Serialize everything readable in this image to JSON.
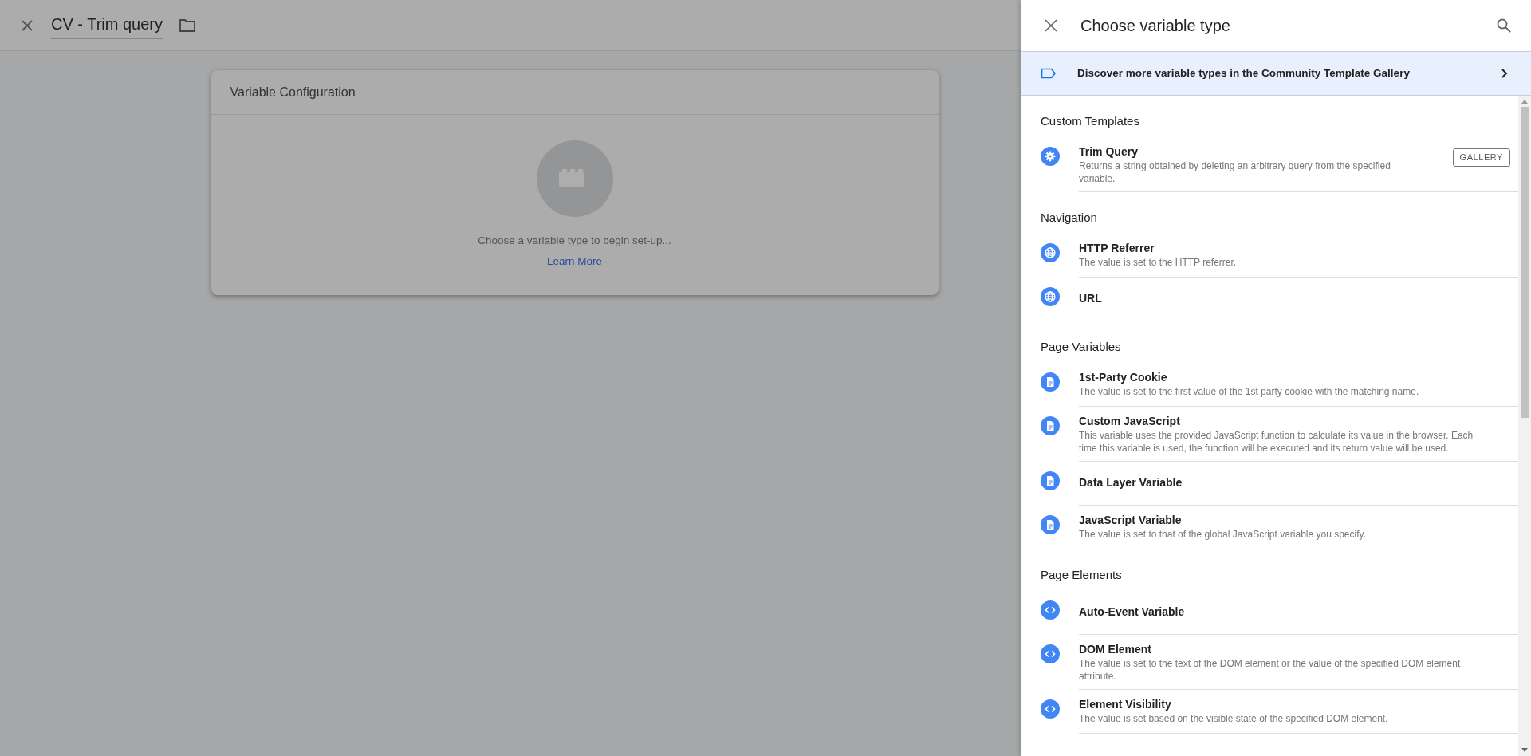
{
  "editor": {
    "title": "CV - Trim query",
    "card": {
      "title": "Variable Configuration",
      "hint": "Choose a variable type to begin set-up...",
      "link": "Learn More"
    }
  },
  "panel": {
    "title": "Choose variable type",
    "banner": "Discover more variable types in the Community Template Gallery",
    "sections": [
      {
        "title": "Custom Templates",
        "items": [
          {
            "kind": "gear",
            "name": "Trim Query",
            "description": "Returns a string obtained by deleting an arbitrary query from the specified variable.",
            "badge": "GALLERY"
          }
        ]
      },
      {
        "title": "Navigation",
        "items": [
          {
            "kind": "globe",
            "name": "HTTP Referrer",
            "description": "The value is set to the HTTP referrer."
          },
          {
            "kind": "globe",
            "name": "URL"
          }
        ]
      },
      {
        "title": "Page Variables",
        "items": [
          {
            "kind": "doc",
            "name": "1st-Party Cookie",
            "description": "The value is set to the first value of the 1st party cookie with the matching name."
          },
          {
            "kind": "doc",
            "name": "Custom JavaScript",
            "description": "This variable uses the provided JavaScript function to calculate its value in the browser. Each time this variable is used, the function will be executed and its return value will be used."
          },
          {
            "kind": "doc",
            "name": "Data Layer Variable"
          },
          {
            "kind": "doc",
            "name": "JavaScript Variable",
            "description": "The value is set to that of the global JavaScript variable you specify."
          }
        ]
      },
      {
        "title": "Page Elements",
        "items": [
          {
            "kind": "code",
            "name": "Auto-Event Variable"
          },
          {
            "kind": "code",
            "name": "DOM Element",
            "description": "The value is set to the text of the DOM element or the value of the specified DOM element attribute."
          },
          {
            "kind": "code",
            "name": "Element Visibility",
            "description": "The value is set based on the visible state of the specified DOM element."
          }
        ]
      }
    ]
  }
}
